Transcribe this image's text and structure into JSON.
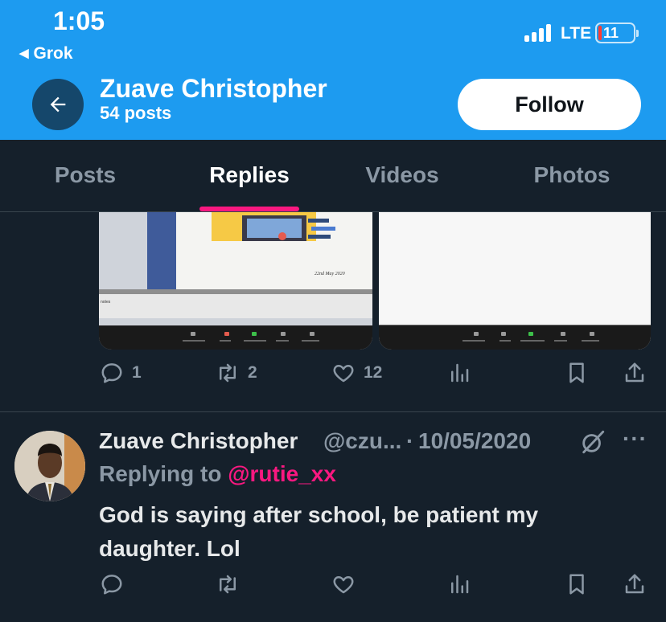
{
  "status_bar": {
    "time": "1:05",
    "back_app": "Grok",
    "network": "LTE",
    "battery": "11"
  },
  "profile": {
    "name": "Zuave Christopher",
    "posts_count": "54 posts",
    "follow_label": "Follow"
  },
  "tabs": [
    {
      "label": "Posts",
      "active": false
    },
    {
      "label": "Replies",
      "active": true
    },
    {
      "label": "Videos",
      "active": false
    },
    {
      "label": "Photos",
      "active": false
    }
  ],
  "colors": {
    "header_bg": "#1d9bf0",
    "page_bg": "#15202b",
    "accent_pink": "#f91880",
    "muted_text": "#8b98a5"
  },
  "previous_tweet": {
    "media_caption_date": "22nd May 2020",
    "media_sidebar_text": "notes",
    "media_toolbar": [
      "Participants",
      "Chat",
      "Share Screen",
      "Record",
      "Reactions"
    ],
    "actions": {
      "replies": "1",
      "reposts": "2",
      "likes": "12"
    }
  },
  "tweet": {
    "author_name": "Zuave Christopher",
    "handle": "@czu...",
    "dot": "·",
    "date": "10/05/2020",
    "replying_prefix": "Replying to",
    "replying_to": "@rutie_xx",
    "body": "God is saying after school, be patient my daughter. Lol",
    "more": "···"
  },
  "icons": [
    "back-arrow-icon",
    "reply-icon",
    "repost-icon",
    "like-icon",
    "views-icon",
    "bookmark-icon",
    "share-icon",
    "grok-icon",
    "more-icon"
  ]
}
